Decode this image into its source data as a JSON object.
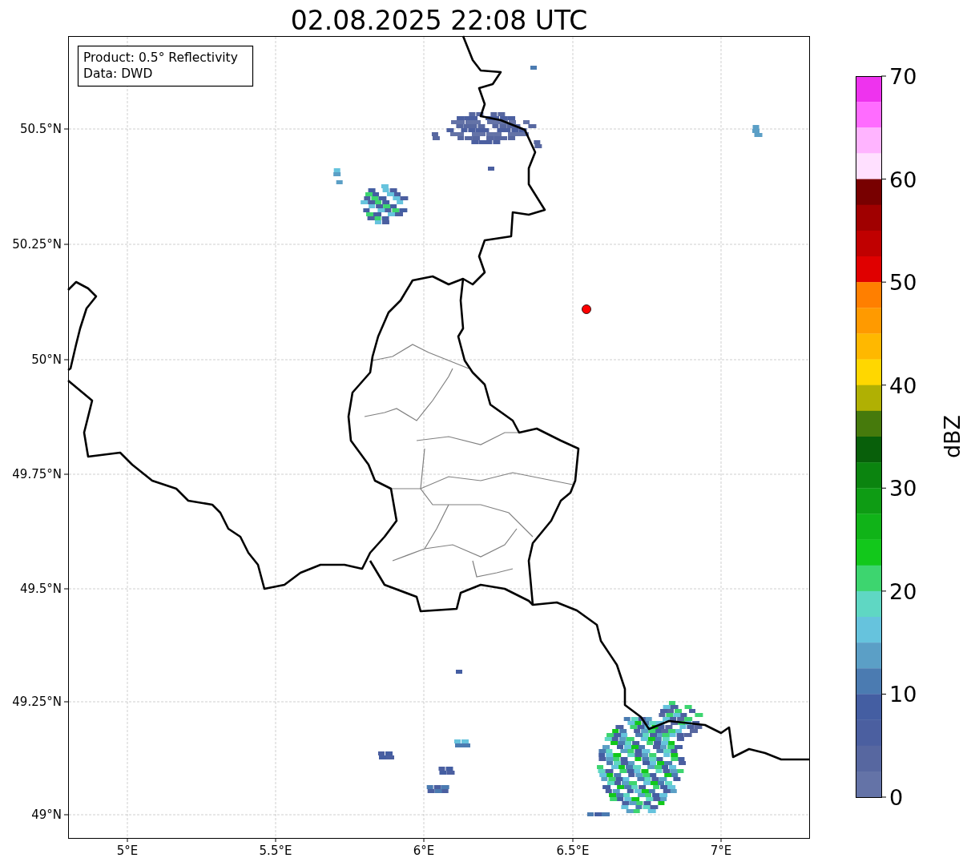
{
  "title": "02.08.2025 22:08 UTC",
  "info_box": {
    "lines": [
      "Product: 0.5° Reflectivity",
      "Data: DWD"
    ]
  },
  "map": {
    "lat_ticks": [
      "50.5°N",
      "50.25°N",
      "50°N",
      "49.75°N",
      "49.5°N",
      "49.25°N",
      "49°N"
    ],
    "lon_ticks": [
      "5°E",
      "5.5°E",
      "6°E",
      "6.5°E",
      "7°E"
    ],
    "marker": {
      "color": "#ff0000"
    }
  },
  "colorbar": {
    "label": "dBZ",
    "ticks": [
      "70",
      "60",
      "50",
      "40",
      "30",
      "20",
      "10",
      "0"
    ],
    "segments": [
      {
        "color": "#ee33ee"
      },
      {
        "color": "#ff6cff"
      },
      {
        "color": "#ffb4ff"
      },
      {
        "color": "#ffe0ff"
      },
      {
        "color": "#780000"
      },
      {
        "color": "#a00000"
      },
      {
        "color": "#c00000"
      },
      {
        "color": "#e00000"
      },
      {
        "color": "#ff7f00"
      },
      {
        "color": "#ff9a00"
      },
      {
        "color": "#ffb800"
      },
      {
        "color": "#ffd700"
      },
      {
        "color": "#b0b003"
      },
      {
        "color": "#467a0c"
      },
      {
        "color": "#085f0a"
      },
      {
        "color": "#0b840f"
      },
      {
        "color": "#0e9c14"
      },
      {
        "color": "#10b318"
      },
      {
        "color": "#12c81b"
      },
      {
        "color": "#3dd56f"
      },
      {
        "color": "#5fd7c3"
      },
      {
        "color": "#66c3dd"
      },
      {
        "color": "#5b9fc6"
      },
      {
        "color": "#4b7bb1"
      },
      {
        "color": "#445ea2"
      },
      {
        "color": "#4b5fa0"
      },
      {
        "color": "#5767a0"
      },
      {
        "color": "#6473a7"
      }
    ]
  }
}
